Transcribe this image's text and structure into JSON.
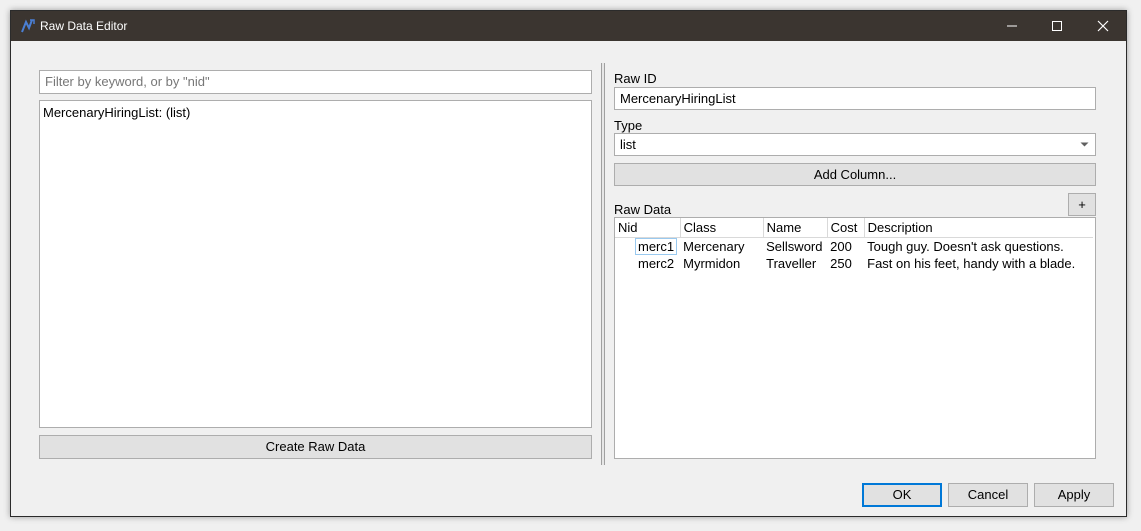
{
  "window": {
    "title": "Raw Data Editor"
  },
  "left": {
    "filter_placeholder": "Filter by keyword, or by \"nid\"",
    "items": [
      "MercenaryHiringList: (list)"
    ],
    "create_label": "Create Raw Data"
  },
  "right": {
    "raw_id_label": "Raw ID",
    "raw_id_value": "MercenaryHiringList",
    "type_label": "Type",
    "type_value": "list",
    "add_column_label": "Add Column...",
    "raw_data_label": "Raw Data",
    "add_row_label": "+",
    "columns": [
      "Nid",
      "Class",
      "Name",
      "Cost",
      "Description"
    ],
    "rows": [
      [
        "merc1",
        "Mercenary",
        "Sellsword",
        "200",
        "Tough guy. Doesn't ask questions."
      ],
      [
        "merc2",
        "Myrmidon",
        "Traveller",
        "250",
        "Fast on his feet, handy with a blade."
      ]
    ]
  },
  "footer": {
    "ok_label": "OK",
    "cancel_label": "Cancel",
    "apply_label": "Apply"
  },
  "colors": {
    "titlebar": "#3b3530",
    "accent": "#0078d7",
    "background": "#f0f0f0"
  }
}
